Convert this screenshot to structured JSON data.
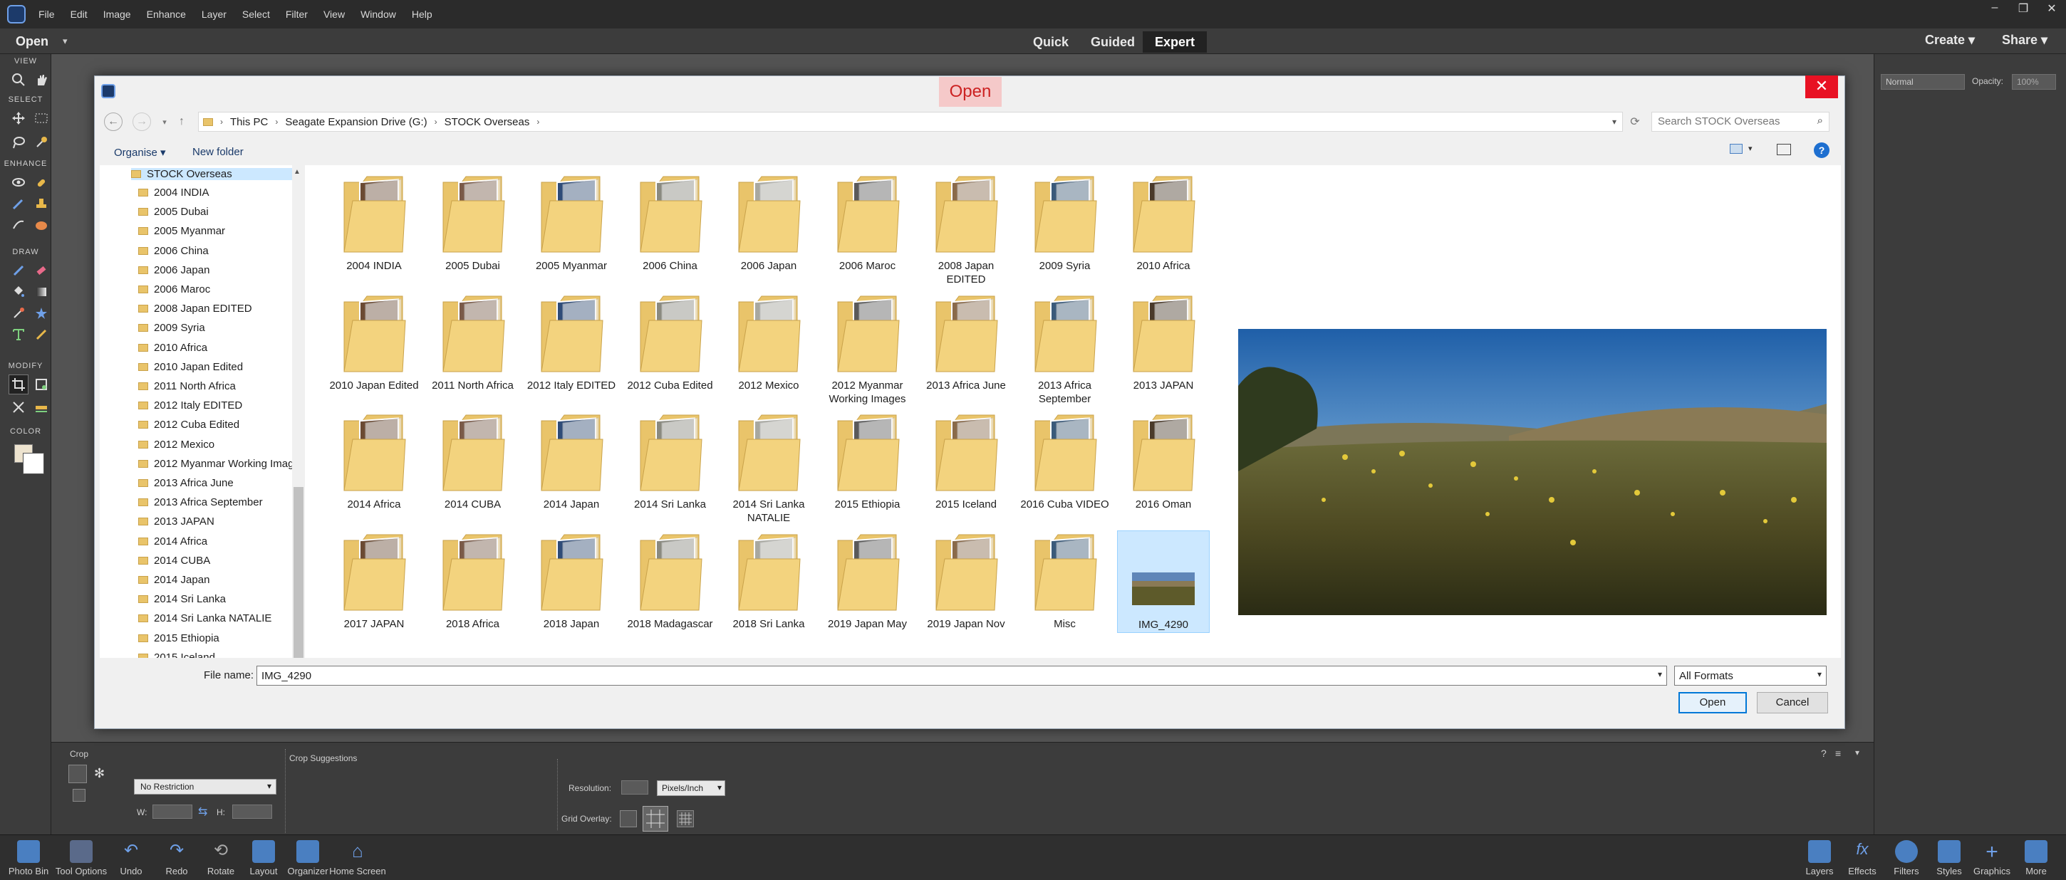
{
  "menubar": {
    "items": [
      "File",
      "Edit",
      "Image",
      "Enhance",
      "Layer",
      "Select",
      "Filter",
      "View",
      "Window",
      "Help"
    ]
  },
  "window_controls": {
    "minimize": "–",
    "restore": "❐",
    "close": "✕"
  },
  "modebar": {
    "open": "Open",
    "quick": "Quick",
    "guided": "Guided",
    "expert": "Expert",
    "create": "Create",
    "share": "Share"
  },
  "toolbar": {
    "sections": [
      "VIEW",
      "SELECT",
      "ENHANCE",
      "DRAW",
      "MODIFY",
      "COLOR"
    ]
  },
  "rightpanel": {
    "blend_mode": "Normal",
    "opacity_label": "Opacity:",
    "opacity_value": "100%"
  },
  "dialog": {
    "title": "Open",
    "close": "✕",
    "breadcrumb": [
      "This PC",
      "Seagate Expansion Drive (G:)",
      "STOCK Overseas"
    ],
    "search_placeholder": "Search STOCK Overseas",
    "organise": "Organise",
    "new_folder": "New folder",
    "nav_root": "STOCK Overseas",
    "nav_items": [
      "2004 INDIA",
      "2005 Dubai",
      "2005 Myanmar",
      "2006 China",
      "2006 Japan",
      "2006 Maroc",
      "2008 Japan EDITED",
      "2009 Syria",
      "2010 Africa",
      "2010 Japan Edited",
      "2011 North Africa",
      "2012  Italy EDITED",
      "2012 Cuba Edited",
      "2012 Mexico",
      "2012 Myanmar Working Images",
      "2013 Africa June",
      "2013 Africa September",
      "2013 JAPAN",
      "2014 Africa",
      "2014 CUBA",
      "2014 Japan",
      "2014 Sri Lanka",
      "2014 Sri Lanka NATALIE",
      "2015 Ethiopia",
      "2015 Iceland"
    ],
    "files": [
      [
        "2004 INDIA",
        "2005 Dubai",
        "2005 Myanmar",
        "2006 China",
        "2006 Japan",
        "2006 Maroc",
        "2008 Japan EDITED",
        "2009 Syria",
        "2010 Africa"
      ],
      [
        "2010 Japan Edited",
        "2011 North Africa",
        "2012  Italy EDITED",
        "2012 Cuba Edited",
        "2012 Mexico",
        "2012 Myanmar Working Images",
        "2013 Africa June",
        "2013 Africa September",
        "2013 JAPAN"
      ],
      [
        "2014 Africa",
        "2014 CUBA",
        "2014 Japan",
        "2014 Sri Lanka",
        "2014 Sri Lanka NATALIE",
        "2015 Ethiopia",
        "2015 Iceland",
        "2016 Cuba VIDEO",
        "2016 Oman"
      ],
      [
        "2017 JAPAN",
        "2018 Africa",
        "2018 Japan",
        "2018 Madagascar",
        "2018 Sri Lanka",
        "2019 Japan May",
        "2019 Japan Nov",
        "Misc",
        "IMG_4290"
      ]
    ],
    "file_name_label": "File name:",
    "file_name_value": "IMG_4290",
    "format": "All Formats",
    "open_button": "Open",
    "cancel_button": "Cancel"
  },
  "tool_options": {
    "crop": "Crop",
    "crop_suggestions": "Crop Suggestions",
    "restriction": "No Restriction",
    "w_label": "W:",
    "h_label": "H:",
    "resolution_label": "Resolution:",
    "units": "Pixels/Inch",
    "grid_overlay": "Grid Overlay:"
  },
  "taskbar": {
    "left": [
      "Photo Bin",
      "Tool Options",
      "Undo",
      "Redo",
      "Rotate",
      "Layout",
      "Organizer",
      "Home Screen"
    ],
    "right": [
      "Layers",
      "Effects",
      "Filters",
      "Styles",
      "Graphics",
      "More"
    ]
  }
}
